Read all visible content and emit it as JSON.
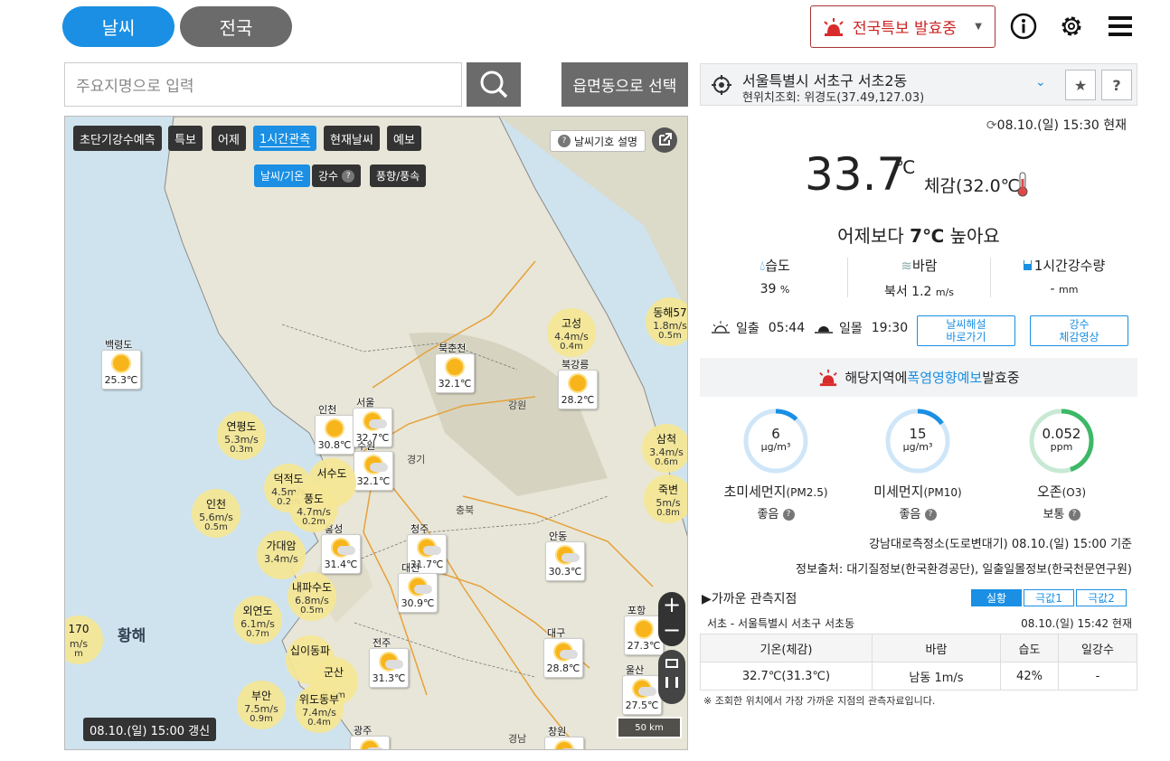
{
  "top_tabs": {
    "weather": "날씨",
    "nation": "전국"
  },
  "warning_button": {
    "label": "전국특보 발효중"
  },
  "search": {
    "placeholder": "주요지명으로 입력",
    "emd_button": "읍면동으로 선택"
  },
  "map": {
    "buttons": [
      "초단기강수예측",
      "특보",
      "어제",
      "1시간관측",
      "현재날씨",
      "예보"
    ],
    "active_button": "1시간관측",
    "sub_buttons": [
      "날씨/기온",
      "강수",
      "풍향/풍속"
    ],
    "legend_button": "날씨기호 설명",
    "sea_label": "황해",
    "scale": "50 km",
    "update_time": "08.10.(일) 15:00 갱신",
    "provinces": [
      "강원",
      "경기",
      "충북",
      "경남"
    ],
    "stations": [
      {
        "name": "백령도",
        "temp": "25.3℃"
      },
      {
        "name": "북춘천",
        "temp": "32.1℃"
      },
      {
        "name": "북강릉",
        "temp": "28.2℃"
      },
      {
        "name": "인천",
        "temp": "30.8℃"
      },
      {
        "name": "서울",
        "temp": "32.7℃"
      },
      {
        "name": "수원",
        "temp": "32.1℃"
      },
      {
        "name": "홍성",
        "temp": "31.4℃"
      },
      {
        "name": "청주",
        "temp": "31.7℃"
      },
      {
        "name": "안동",
        "temp": "30.3℃"
      },
      {
        "name": "대전",
        "temp": "30.9℃"
      },
      {
        "name": "포항",
        "temp": "27.3℃"
      },
      {
        "name": "대구",
        "temp": "28.8℃"
      },
      {
        "name": "전주",
        "temp": "31.3℃"
      },
      {
        "name": "울산",
        "temp": "27.5℃"
      },
      {
        "name": "광주",
        "temp": ""
      },
      {
        "name": "창원",
        "temp": ""
      }
    ],
    "wind_stations": [
      {
        "name": "고성",
        "speed": "4.4",
        "unit": "m/s",
        "val2": "0.4m"
      },
      {
        "name": "동해57",
        "speed": "1.8",
        "unit": "m/s",
        "val2": "0.5m"
      },
      {
        "name": "연평도",
        "speed": "5.3",
        "unit": "m/s",
        "val2": "0.3m"
      },
      {
        "name": "삼척",
        "speed": "3.4",
        "unit": "m/s",
        "val2": "0.6m"
      },
      {
        "name": "덕적도",
        "speed": "4.5",
        "unit": "m/s",
        "val2": "0.2m"
      },
      {
        "name": "서수도",
        "speed": "",
        "unit": "",
        "val2": ""
      },
      {
        "name": "풍도",
        "speed": "4.7",
        "unit": "m/s",
        "val2": "0.2m"
      },
      {
        "name": "인천",
        "speed": "5.6",
        "unit": "m/s",
        "val2": "0.5m"
      },
      {
        "name": "죽변",
        "speed": "5",
        "unit": "m/s",
        "val2": "0.8m"
      },
      {
        "name": "가대암",
        "speed": "3.4",
        "unit": "m/s",
        "val2": ""
      },
      {
        "name": "내파수도",
        "speed": "6.8",
        "unit": "m/s",
        "val2": "0.5m"
      },
      {
        "name": "외연도",
        "speed": "6.1",
        "unit": "m/s",
        "val2": "0.7m"
      },
      {
        "name": "170",
        "speed": "",
        "unit": "m/s",
        "val2": "m"
      },
      {
        "name": "십이동파",
        "speed": "",
        "unit": "",
        "val2": ""
      },
      {
        "name": "군산",
        "speed": "",
        "unit": "",
        "val2": "0.4m"
      },
      {
        "name": "부안",
        "speed": "7.5",
        "unit": "m/s",
        "val2": "0.9m"
      },
      {
        "name": "위도동부",
        "speed": "7.4",
        "unit": "m/s",
        "val2": "0.4m"
      }
    ]
  },
  "location": {
    "name": "서울특별시 서초구 서초2동",
    "coords": "현위치조회: 위경도(37.49,127.03)"
  },
  "current": {
    "time": "08.10.(일) 15:30 현재",
    "temp": "33.7",
    "unit": "℃",
    "feels": "체감(32.0℃)",
    "compare_prefix": "어제보다 ",
    "compare_value": "7℃",
    "compare_suffix": " 높아요",
    "humidity_label": "습도",
    "humidity_value": "39",
    "humidity_unit": "%",
    "wind_label": "바람",
    "wind_value": "북서 1.2",
    "wind_unit": "m/s",
    "rain_label": "1시간강수량",
    "rain_value": "-",
    "rain_unit": "mm"
  },
  "sun": {
    "rise_label": "일출",
    "rise": "05:44",
    "set_label": "일몰",
    "set": "19:30"
  },
  "links": {
    "commentary": "날씨해설\n바로가기",
    "video": "강수\n체감영상"
  },
  "alert": {
    "prefix": "해당지역에 ",
    "highlight": "폭염영향예보",
    "suffix": " 발효중"
  },
  "air": {
    "items": [
      {
        "value": "6",
        "unit": "μg/m³",
        "label": "초미세먼지",
        "sub": "(PM2.5)",
        "grade": "좋음",
        "fraction": 0.12,
        "color": "#1a8fe3"
      },
      {
        "value": "15",
        "unit": "μg/m³",
        "label": "미세먼지",
        "sub": "(PM10)",
        "grade": "좋음",
        "fraction": 0.15,
        "color": "#1a8fe3"
      },
      {
        "value": "0.052",
        "unit": "ppm",
        "label": "오존",
        "sub": "(O3)",
        "grade": "보통",
        "fraction": 0.45,
        "color": "#3db867"
      }
    ],
    "station": "강남대로측정소(도로변대기) 08.10.(일) 15:00 기준",
    "source": "정보출처: 대기질정보(한국환경공단), 일출일몰정보(한국천문연구원)"
  },
  "nearby": {
    "title": "▶가까운 관측지점",
    "tabs": [
      "실황",
      "극값1",
      "극값2"
    ],
    "station": "서초 - 서울특별시 서초구 서초동",
    "time": "08.10.(일) 15:42 현재",
    "headers": [
      "기온(체감)",
      "바람",
      "습도",
      "일강수"
    ],
    "row": [
      "32.7℃(31.3℃)",
      "남동 1m/s",
      "42%",
      "-"
    ],
    "note": "※ 조회한 위치에서 가장 가까운 지점의 관측자료입니다."
  }
}
